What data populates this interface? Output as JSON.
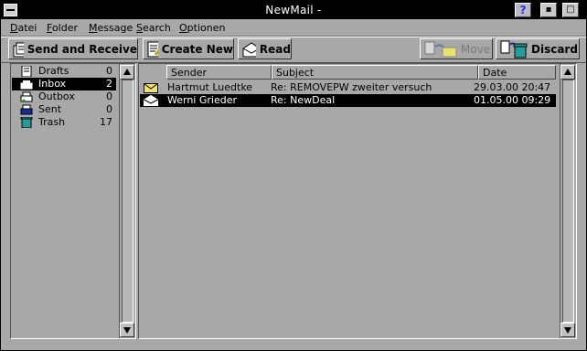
{
  "window": {
    "title": "NewMail -",
    "help_label": "?",
    "min_label": "▪",
    "max_label": "□"
  },
  "menu": [
    {
      "label": "Datei",
      "accel": "D",
      "rest": "atei"
    },
    {
      "label": "Folder",
      "accel": "F",
      "rest": "older"
    },
    {
      "label": "Message",
      "accel": "M",
      "rest": "essage"
    },
    {
      "label": "Search",
      "accel": "S",
      "rest": "earch"
    },
    {
      "label": "Optionen",
      "accel": "O",
      "rest": "ptionen"
    }
  ],
  "toolbar": {
    "send_receive": "Send and Receive",
    "create_new": "Create New",
    "read": "Read",
    "move": "Move",
    "discard": "Discard"
  },
  "folders": [
    {
      "name": "Drafts",
      "count": "0",
      "icon": "draft-icon"
    },
    {
      "name": "Inbox",
      "count": "2",
      "icon": "inbox-icon",
      "selected": true
    },
    {
      "name": "Outbox",
      "count": "0",
      "icon": "outbox-icon"
    },
    {
      "name": "Sent",
      "count": "0",
      "icon": "sent-icon"
    },
    {
      "name": "Trash",
      "count": "17",
      "icon": "trash-icon"
    }
  ],
  "columns": {
    "sender": "Sender",
    "subject": "Subject",
    "date": "Date"
  },
  "messages": [
    {
      "sender": "Hartmut Luedtke",
      "subject": "Re: REMOVEPW zweiter versuch",
      "date": "29.03.00 20:47",
      "icon": "envelope-closed-icon"
    },
    {
      "sender": "Werni Grieder",
      "subject": "Re: NewDeal",
      "date": "01.05.00 09:29",
      "icon": "envelope-open-icon",
      "selected": true
    }
  ]
}
